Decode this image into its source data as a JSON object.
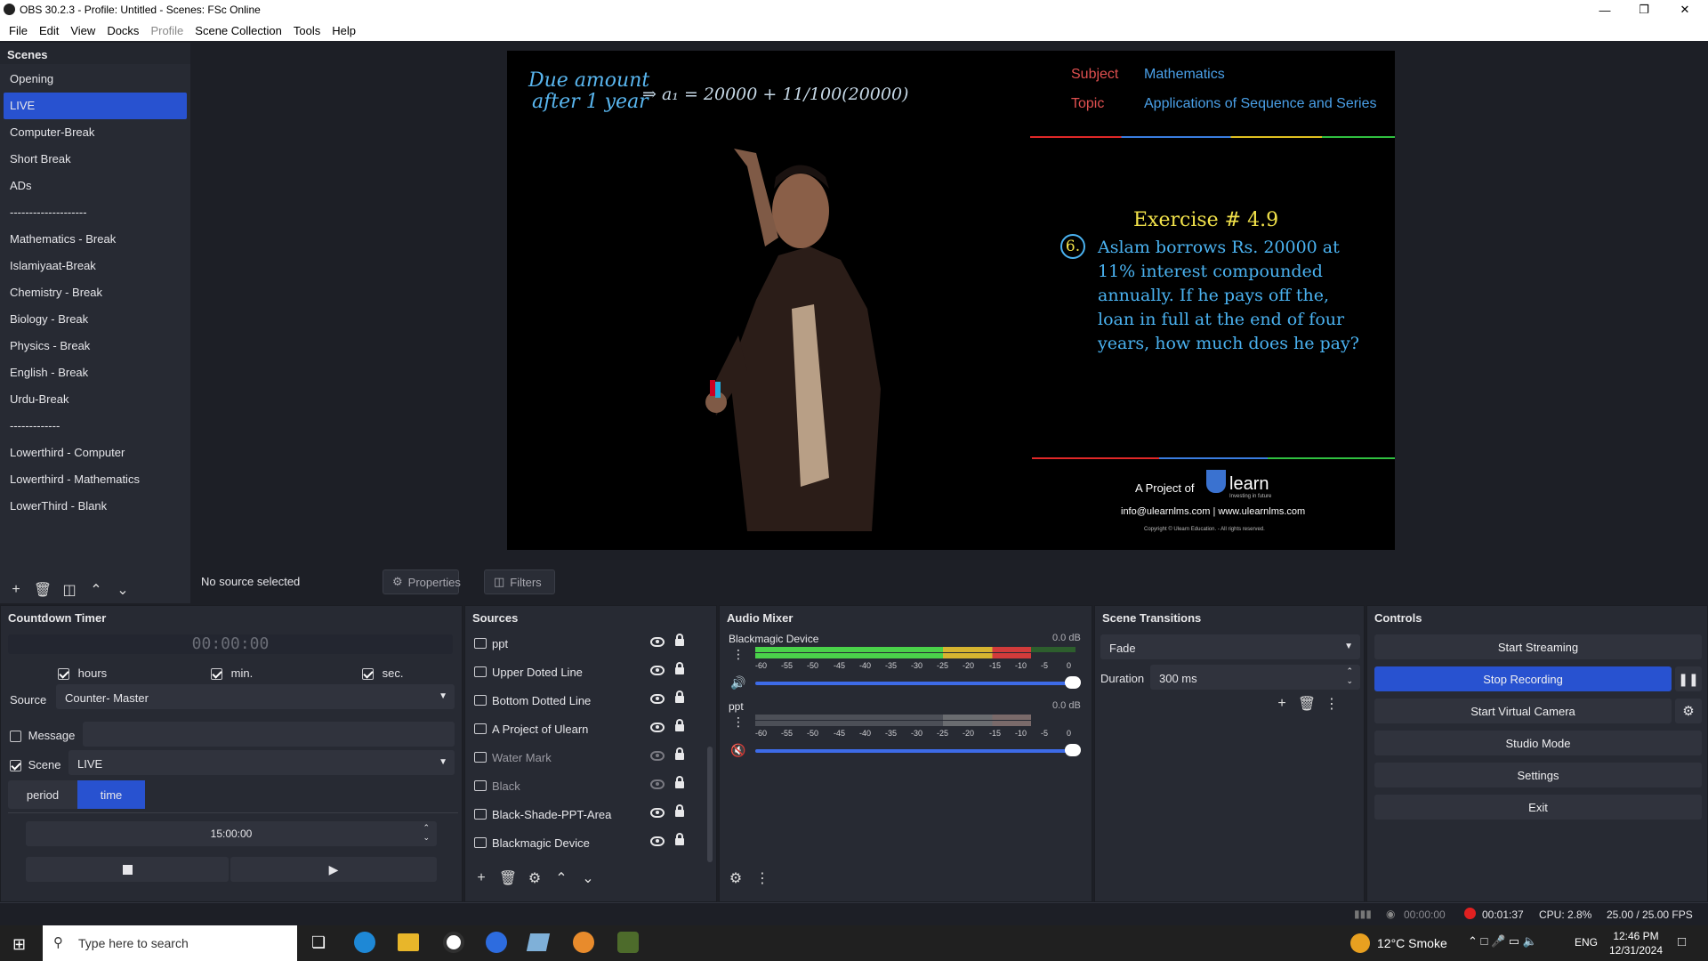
{
  "window": {
    "title": "OBS 30.2.3 - Profile: Untitled - Scenes: FSc Online"
  },
  "menu": [
    "File",
    "Edit",
    "View",
    "Docks",
    "Profile",
    "Scene Collection",
    "Tools",
    "Help"
  ],
  "scenes": {
    "title": "Scenes",
    "items": [
      "Opening",
      "LIVE",
      "Computer-Break",
      "Short Break",
      "ADs",
      "--------------------",
      "Mathematics - Break",
      "Islamiyaat-Break",
      "Chemistry - Break",
      "Biology - Break",
      "Physics - Break",
      "English - Break",
      "Urdu-Break",
      "-------------",
      "Lowerthird - Computer",
      "Lowerthird - Mathematics",
      "LowerThird - Blank"
    ],
    "selected": "LIVE"
  },
  "preview": {
    "handwriting_line1": "Due amount",
    "handwriting_line2": "after 1 year",
    "formula": "⇒ a₁ = 20000 + 11/100(20000)",
    "subject_label": "Subject",
    "subject_value": "Mathematics",
    "topic_label": "Topic",
    "topic_value": "Applications of Sequence and Series",
    "exercise_title": "Exercise # 4.9",
    "question_number": "6.",
    "question_line1": "Aslam borrows Rs. 20000 at",
    "question_line2": "11% interest compounded",
    "question_line3": "annually. If he pays off the,",
    "question_line4": "loan in full at the end of four",
    "question_line5": "years, how much does he pay?",
    "project_text": "A Project of",
    "brand": "learn",
    "brand_tagline": "Investing in future",
    "contact": "info@ulearnlms.com | www.ulearnlms.com",
    "copyright": "Copyright © Ulearn Education. - All rights reserved."
  },
  "context_bar": {
    "status": "No source selected",
    "properties": "Properties",
    "filters": "Filters"
  },
  "countdown": {
    "title": "Countdown Timer",
    "display": "00:00:00",
    "hours_label": "hours",
    "min_label": "min.",
    "sec_label": "sec.",
    "source_label": "Source",
    "source_value": "Counter- Master",
    "message_label": "Message",
    "scene_label": "Scene",
    "scene_value": "LIVE",
    "tab_period": "period",
    "tab_time": "time",
    "time_value": "15:00:00"
  },
  "sources": {
    "title": "Sources",
    "items": [
      {
        "name": "ppt",
        "visible": true
      },
      {
        "name": "Upper Doted Line",
        "visible": true
      },
      {
        "name": "Bottom Dotted Line",
        "visible": true
      },
      {
        "name": "A Project of Ulearn",
        "visible": true
      },
      {
        "name": "Water Mark",
        "visible": false
      },
      {
        "name": "Black",
        "visible": false
      },
      {
        "name": "Black-Shade-PPT-Area",
        "visible": true
      },
      {
        "name": "Blackmagic Device",
        "visible": true
      }
    ]
  },
  "audio": {
    "title": "Audio Mixer",
    "channels": [
      {
        "name": "Blackmagic Device",
        "db": "0.0 dB",
        "muted": false,
        "level_fraction": 0.86
      },
      {
        "name": "ppt",
        "db": "0.0 dB",
        "muted": true,
        "level_fraction": 0.86
      }
    ],
    "ticks": [
      "-60",
      "-55",
      "-50",
      "-45",
      "-40",
      "-35",
      "-30",
      "-25",
      "-20",
      "-15",
      "-10",
      "-5",
      "0"
    ]
  },
  "transitions": {
    "title": "Scene Transitions",
    "value": "Fade",
    "duration_label": "Duration",
    "duration_value": "300 ms"
  },
  "controls": {
    "title": "Controls",
    "start_streaming": "Start Streaming",
    "stop_recording": "Stop Recording",
    "start_virtual_camera": "Start Virtual Camera",
    "studio_mode": "Studio Mode",
    "settings": "Settings",
    "exit": "Exit"
  },
  "status": {
    "stream_time": "00:00:00",
    "rec_time": "00:01:37",
    "cpu": "CPU: 2.8%",
    "fps": "25.00 / 25.00 FPS"
  },
  "taskbar": {
    "search_placeholder": "Type here to search",
    "weather": "12°C  Smoke",
    "lang": "ENG",
    "time": "12:46 PM",
    "date": "12/31/2024"
  },
  "colors": {
    "accent": "#2852d0",
    "panel": "#272a33",
    "background": "#1d1f26",
    "rec_red": "#e02020"
  }
}
